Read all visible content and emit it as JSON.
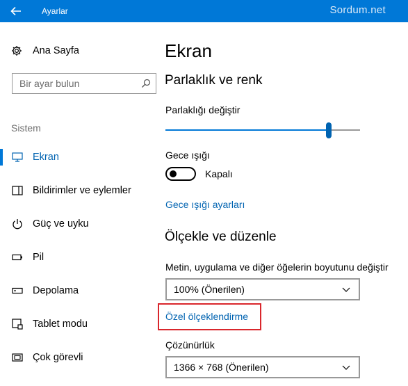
{
  "window": {
    "title": "Ayarlar",
    "watermark": "Sordum.net",
    "accent": "#0078d7",
    "highlight_color": "#d9262c",
    "back_icon": "arrow-left-icon"
  },
  "sidebar": {
    "home_label": "Ana Sayfa",
    "home_icon": "gear-icon",
    "search_placeholder": "Bir ayar bulun",
    "search_icon": "search-icon",
    "section_label": "Sistem",
    "items": [
      {
        "label": "Ekran",
        "icon": "monitor-icon",
        "active": true
      },
      {
        "label": "Bildirimler ve eylemler",
        "icon": "notification-icon",
        "active": false
      },
      {
        "label": "Güç ve uyku",
        "icon": "power-icon",
        "active": false
      },
      {
        "label": "Pil",
        "icon": "battery-icon",
        "active": false
      },
      {
        "label": "Depolama",
        "icon": "storage-icon",
        "active": false
      },
      {
        "label": "Tablet modu",
        "icon": "tablet-icon",
        "active": false
      },
      {
        "label": "Çok görevli",
        "icon": "multitask-icon",
        "active": false
      }
    ]
  },
  "main": {
    "page_title": "Ekran",
    "brightness_section": {
      "title": "Parlaklık ve renk",
      "slider_label": "Parlaklığı değiştir",
      "brightness_value": 0.84,
      "night_light_label": "Gece ışığı",
      "toggle_state": "Kapalı",
      "night_light_link": "Gece ışığı ayarları"
    },
    "scale_section": {
      "title": "Ölçekle ve düzenle",
      "scale_label": "Metin, uygulama ve diğer öğelerin boyutunu değiştir",
      "scale_value": "100% (Önerilen)",
      "custom_scaling_link": "Özel ölçeklendirme",
      "resolution_label": "Çözünürlük",
      "resolution_value": "1366 × 768 (Önerilen)"
    }
  }
}
